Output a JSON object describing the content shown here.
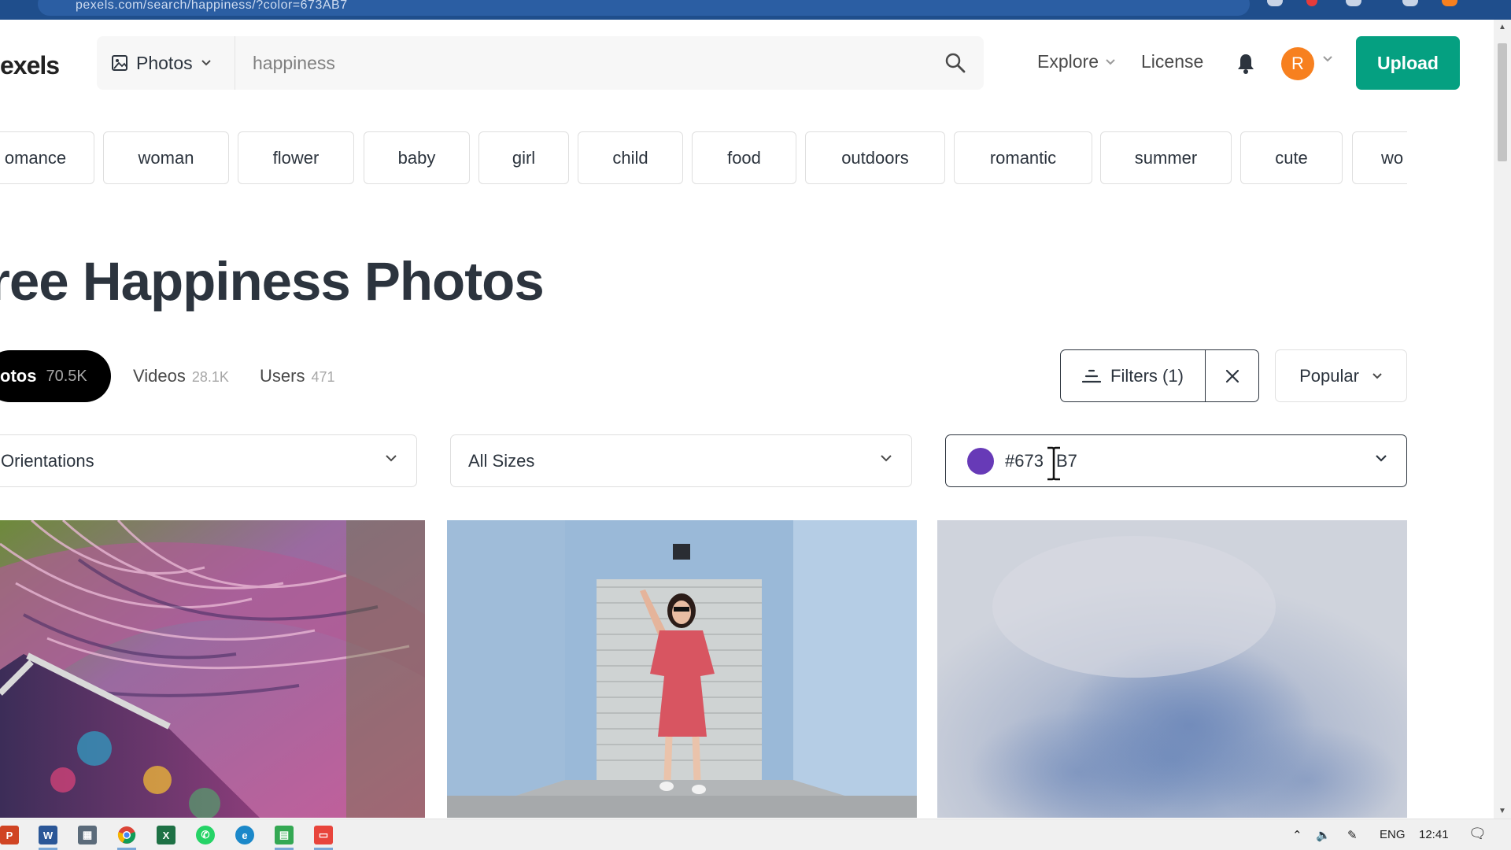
{
  "browser": {
    "url_text": "pexels.com/search/happiness/?color=673AB7"
  },
  "header": {
    "logo": "exels",
    "search_type": "Photos",
    "search_value": "happiness",
    "nav_explore": "Explore",
    "nav_license": "License",
    "avatar_initial": "R",
    "upload_label": "Upload"
  },
  "chips": [
    "omance",
    "woman",
    "flower",
    "baby",
    "girl",
    "child",
    "food",
    "outdoors",
    "romantic",
    "summer",
    "cute",
    "wo"
  ],
  "page_title": "ree Happiness Photos",
  "tabs": {
    "photos_label": "otos",
    "photos_count": "70.5K",
    "videos_label": "Videos",
    "videos_count": "28.1K",
    "users_label": "Users",
    "users_count": "471"
  },
  "filters": {
    "filters_label": "Filters (1)",
    "sort_label": "Popular",
    "orientation": "Orientations",
    "size": "All Sizes",
    "color_value": "#673AB7",
    "color_swatch": "#673ab7",
    "color_text_left": "#673",
    "color_text_right": "B7"
  },
  "taskbar": {
    "apps": [
      "powerpoint",
      "word",
      "calculator",
      "chrome",
      "excel",
      "whatsapp",
      "edge",
      "sheets",
      "presentation"
    ],
    "lang": "ENG",
    "time": "12:41"
  },
  "colors": {
    "accent": "#05a081",
    "avatar": "#f7801f",
    "active_tab": "#000000"
  }
}
